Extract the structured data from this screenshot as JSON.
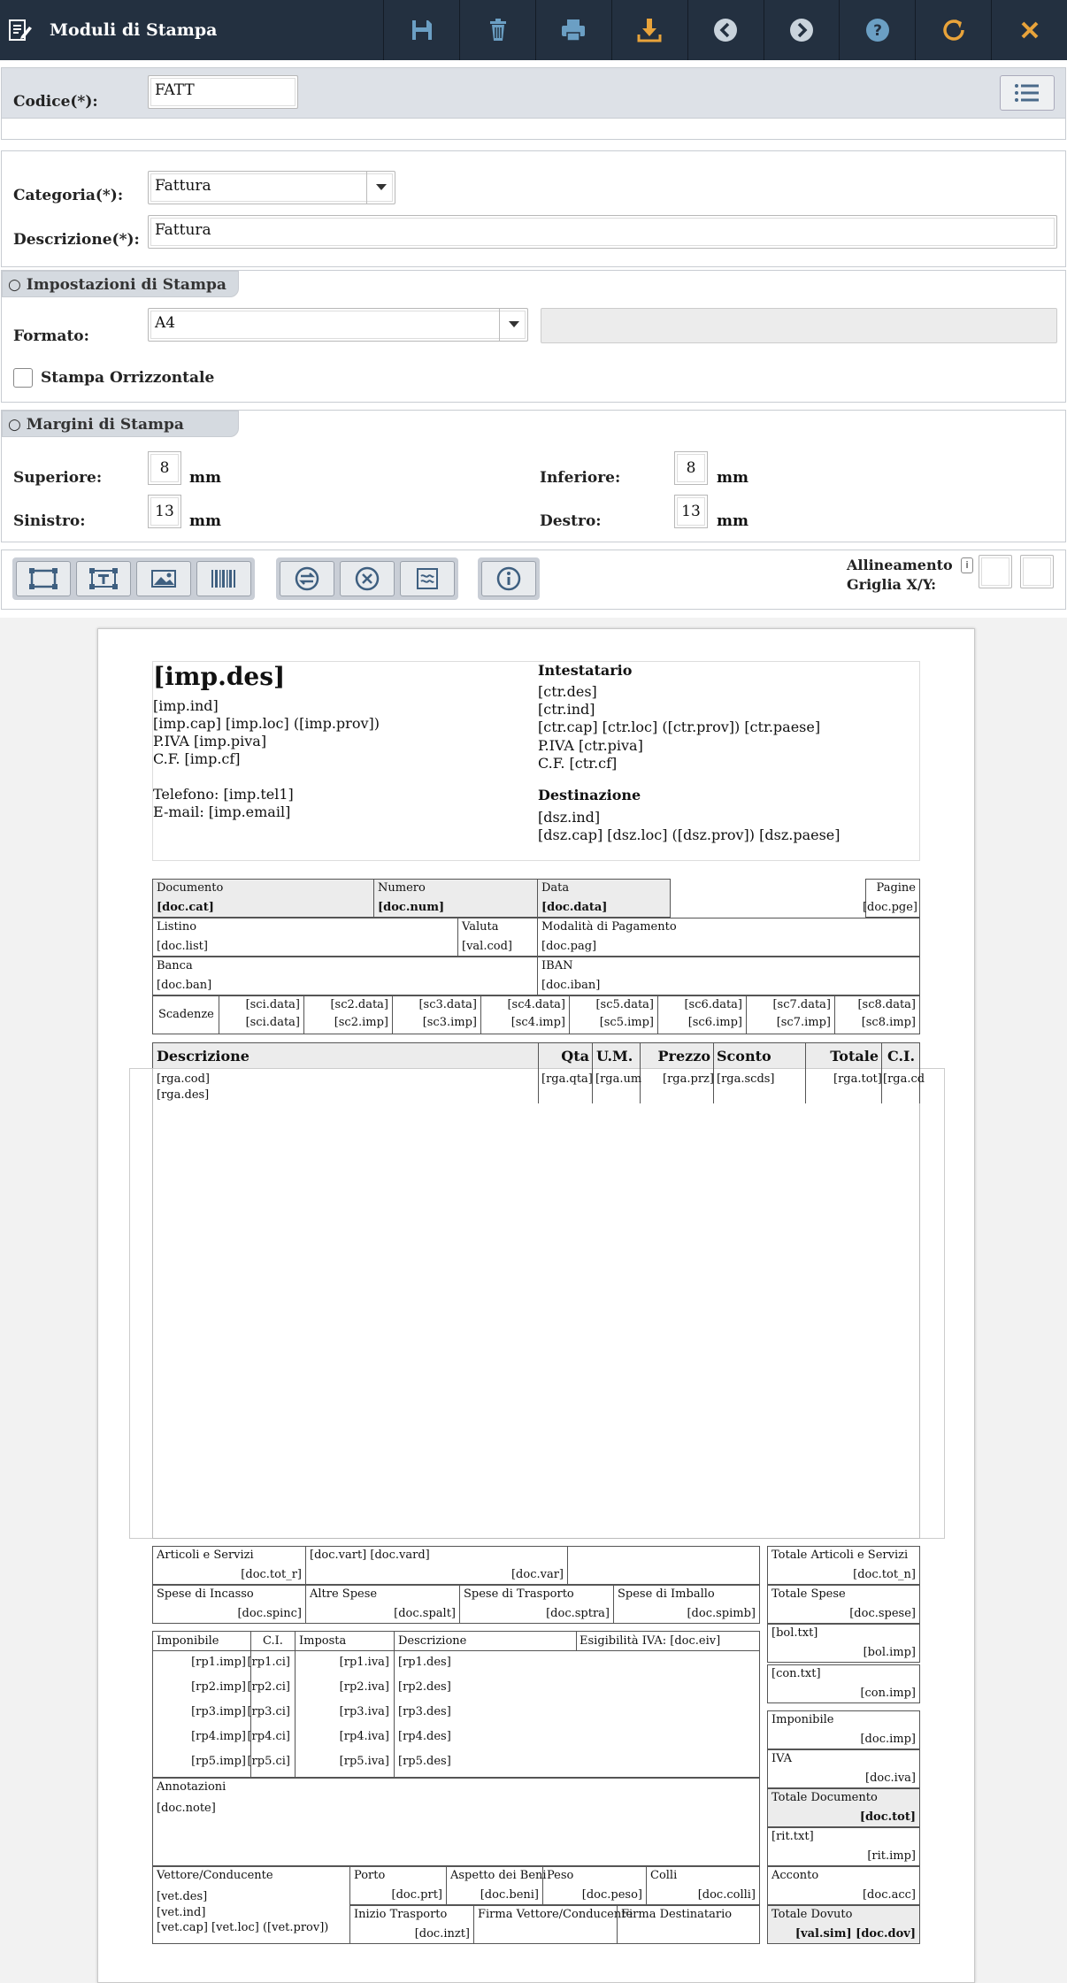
{
  "app": {
    "title": "Moduli di Stampa"
  },
  "toolbar": {
    "buttons": [
      "save-icon",
      "delete-icon",
      "print-icon",
      "download-icon",
      "previous-icon",
      "next-icon",
      "help-icon",
      "refresh-icon",
      "close-icon"
    ]
  },
  "form": {
    "codice_label": "Codice(*):",
    "codice_value": "FATT",
    "categoria_label": "Categoria(*):",
    "categoria_value": "Fattura",
    "descrizione_label": "Descrizione(*):",
    "descrizione_value": "Fattura"
  },
  "impostazioni": {
    "title": "○ Impostazioni di Stampa",
    "formato_label": "Formato:",
    "formato_value": "A4",
    "orizzontale_label": "Stampa Orrizzontale"
  },
  "margini": {
    "title": "○ Margini di Stampa",
    "superiore_label": "Superiore:",
    "superiore_value": "8",
    "inferiore_label": "Inferiore:",
    "inferiore_value": "8",
    "sinistro_label": "Sinistro:",
    "sinistro_value": "13",
    "destro_label": "Destro:",
    "destro_value": "13",
    "unit": "mm"
  },
  "tools": {
    "align_label_1": "Allineamento",
    "align_label_2": "Griglia X/Y:",
    "info_glyph": "i"
  },
  "doc": {
    "imp_des": "[imp.des]",
    "imp_ind": "[imp.ind]",
    "imp_cap": "[imp.cap] [imp.loc] ([imp.prov])",
    "imp_piva": "P.IVA [imp.piva]",
    "imp_cf": "C.F. [imp.cf]",
    "imp_tel": "Telefono: [imp.tel1]",
    "imp_email": "E-mail: [imp.email]",
    "int_title": "Intestatario",
    "ctr_des": "[ctr.des]",
    "ctr_ind": "[ctr.ind]",
    "ctr_cap": "[ctr.cap] [ctr.loc] ([ctr.prov]) [ctr.paese]",
    "ctr_piva": "P.IVA [ctr.piva]",
    "ctr_cf": "C.F. [ctr.cf]",
    "dst_title": "Destinazione",
    "dsz_ind": "[dsz.ind]",
    "dsz_cap": "[dsz.cap] [dsz.loc] ([dsz.prov]) [dsz.paese]",
    "documento": "Documento",
    "doc_cat": "[doc.cat]",
    "numero": "Numero",
    "doc_num": "[doc.num]",
    "data": "Data",
    "doc_data": "[doc.data]",
    "pagine": "Pagine",
    "doc_pge": "[doc.pge]",
    "listino": "Listino",
    "doc_list": "[doc.list]",
    "valuta": "Valuta",
    "val_cod": "[val.cod]",
    "modalita": "Modalità di Pagamento",
    "doc_pag": "[doc.pag]",
    "banca": "Banca",
    "doc_ban": "[doc.ban]",
    "iban": "IBAN",
    "doc_iban": "[doc.iban]",
    "scadenze": "Scadenze",
    "sc": [
      [
        "[sci.data]",
        "[sci.data]"
      ],
      [
        "[sc2.data]",
        "[sc2.imp]"
      ],
      [
        "[sc3.data]",
        "[sc3.imp]"
      ],
      [
        "[sc4.data]",
        "[sc4.imp]"
      ],
      [
        "[sc5.data]",
        "[sc5.imp]"
      ],
      [
        "[sc6.data]",
        "[sc6.imp]"
      ],
      [
        "[sc7.data]",
        "[sc7.imp]"
      ],
      [
        "[sc8.data]",
        "[sc8.imp]"
      ]
    ],
    "h_desc": "Descrizione",
    "h_qta": "Qta",
    "h_um": "U.M.",
    "h_prz": "Prezzo",
    "h_sconto": "Sconto",
    "h_tot": "Totale",
    "h_ci": "C.I.",
    "rga_cod": "[rga.cod]",
    "rga_des": "[rga.des]",
    "rga_qta": "[rga.qta]",
    "rga_um": "[rga.um",
    "rga_prz": "[rga.prz]",
    "rga_scds": "[rga.scds]",
    "rga_tot": "[rga.tot]",
    "rga_cd": "[rga.cd",
    "art_serv": "Articoli e Servizi",
    "doc_tot_r": "[doc.tot_r]",
    "doc_vart": "[doc.vart] [doc.vard]",
    "doc_var": "[doc.var]",
    "tot_art": "Totale Articoli e Servizi",
    "doc_tot_n": "[doc.tot_n]",
    "spese_inc": "Spese di Incasso",
    "doc_spinc": "[doc.spinc]",
    "altre_spese": "Altre Spese",
    "doc_spalt": "[doc.spalt]",
    "spese_tr": "Spese di Trasporto",
    "doc_sptra": "[doc.sptra]",
    "spese_imb": "Spese di Imballo",
    "doc_spimb": "[doc.spimb]",
    "tot_spese": "Totale Spese",
    "doc_spese": "[doc.spese]",
    "imponibile": "Imponibile",
    "ci": "C.I.",
    "imposta": "Imposta",
    "descrizione": "Descrizione",
    "esig": "Esigibilità IVA: [doc.eiv]",
    "rp": [
      [
        "[rp1.imp]",
        "[rp1.ci]",
        "[rp1.iva]",
        "[rp1.des]"
      ],
      [
        "[rp2.imp]",
        "[rp2.ci]",
        "[rp2.iva]",
        "[rp2.des]"
      ],
      [
        "[rp3.imp]",
        "[rp3.ci]",
        "[rp3.iva]",
        "[rp3.des]"
      ],
      [
        "[rp4.imp]",
        "[rp4.ci]",
        "[rp4.iva]",
        "[rp4.des]"
      ],
      [
        "[rp5.imp]",
        "[rp5.ci]",
        "[rp5.iva]",
        "[rp5.des]"
      ]
    ],
    "bol_txt": "[bol.txt]",
    "bol_imp": "[bol.imp]",
    "con_txt": "[con.txt]",
    "con_imp": "[con.imp]",
    "imponibile_r": "Imponibile",
    "doc_imp": "[doc.imp]",
    "iva": "IVA",
    "doc_iva": "[doc.iva]",
    "tot_doc": "Totale Documento",
    "doc_tot": "[doc.tot]",
    "rit_txt": "[rit.txt]",
    "rit_imp": "[rit.imp]",
    "acconto": "Acconto",
    "doc_acc": "[doc.acc]",
    "tot_dovuto": "Totale Dovuto",
    "doc_dov": "[val.sim] [doc.dov]",
    "annotazioni": "Annotazioni",
    "doc_note": "[doc.note]",
    "vettore": "Vettore/Conducente",
    "vet_des": "[vet.des]",
    "vet_ind": "[vet.ind]",
    "vet_cap": "[vet.cap] [vet.loc] ([vet.prov])",
    "porto": "Porto",
    "doc_prt": "[doc.prt]",
    "aspetto": "Aspetto dei Beni",
    "doc_beni": "[doc.beni]",
    "peso": "Peso",
    "doc_peso": "[doc.peso]",
    "colli": "Colli",
    "doc_colli": "[doc.colli]",
    "inizio": "Inizio Trasporto",
    "doc_inzt": "[doc.inzt]",
    "firma_vet": "Firma Vettore/Conducente",
    "firma_dest": "Firma Destinatario"
  }
}
